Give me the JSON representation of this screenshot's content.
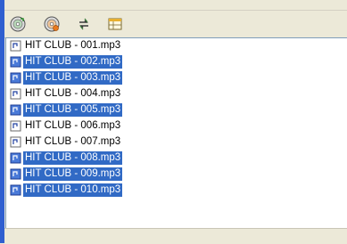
{
  "toolbar": {
    "buttons": [
      {
        "name": "add-disc-button",
        "icon": "disc-icon"
      },
      {
        "name": "disc-settings-button",
        "icon": "disc-orange-icon"
      },
      {
        "name": "refresh-button",
        "icon": "sync-arrows-icon"
      },
      {
        "name": "view-button",
        "icon": "grid-view-icon"
      }
    ]
  },
  "files": [
    {
      "label": "HIT CLUB - 001.mp3",
      "selected": false
    },
    {
      "label": "HIT CLUB - 002.mp3",
      "selected": true
    },
    {
      "label": "HIT CLUB - 003.mp3",
      "selected": true
    },
    {
      "label": "HIT CLUB - 004.mp3",
      "selected": false
    },
    {
      "label": "HIT CLUB - 005.mp3",
      "selected": true
    },
    {
      "label": "HIT CLUB - 006.mp3",
      "selected": false
    },
    {
      "label": "HIT CLUB - 007.mp3",
      "selected": false
    },
    {
      "label": "HIT CLUB - 008.mp3",
      "selected": true
    },
    {
      "label": "HIT CLUB - 009.mp3",
      "selected": true
    },
    {
      "label": "HIT CLUB - 010.mp3",
      "selected": true
    }
  ],
  "colors": {
    "selection": "#316ac5",
    "selection_text": "#ffffff",
    "rail": "#2f5fd0"
  }
}
